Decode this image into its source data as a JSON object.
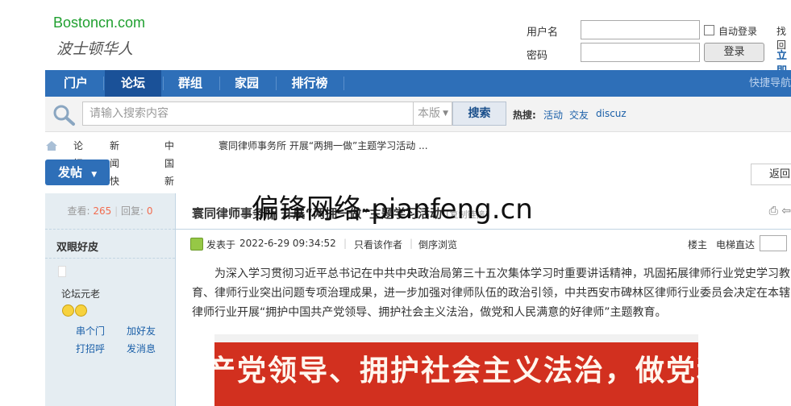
{
  "header": {
    "logo_en": "Bostoncn.com",
    "logo_cn": "波士顿华人",
    "username_label": "用户名",
    "password_label": "密码",
    "auto_login_label": "自动登录",
    "login_button": "登录",
    "retrieve_password": "找回",
    "register": "立即"
  },
  "nav": {
    "items": [
      "门户",
      "论坛",
      "群组",
      "家园",
      "排行榜"
    ],
    "active": "论坛",
    "quick_nav": "快捷导航"
  },
  "search": {
    "placeholder": "请输入搜索内容",
    "scope": "本版",
    "button": "搜索",
    "hot_label": "热搜:",
    "hot_links": [
      "活动",
      "交友",
      "discuz"
    ]
  },
  "breadcrumb": [
    "论坛",
    "新闻快递",
    "中国新闻",
    "寰同律师事务所 开展“两拥一做”主题学习活动 ..."
  ],
  "actions": {
    "post_button": "发帖",
    "back_button": "返回"
  },
  "sidebar": {
    "views_label": "查看:",
    "views_value": "265",
    "replies_label": "回复:",
    "replies_value": "0",
    "username": "双眼好皮",
    "user_level": "论坛元老",
    "links": [
      "串个门",
      "加好友",
      "打招呼",
      "发消息"
    ]
  },
  "post": {
    "title": "寰同律师事务所 开展“两拥一做”主题学习活动",
    "title_tag": "[复制链接]",
    "watermark": "偏锋网络-pianfeng.cn",
    "posted_prefix": "发表于",
    "posted_time": "2022-6-29 09:34:52",
    "author_only": "只看该作者",
    "reverse_view": "倒序浏览",
    "floor_label": "楼主",
    "elevator_label": "电梯直达",
    "body_lines": [
      "为深入学习贯彻习近平总书记在中共中央政治局第三十五次集体学习时重要讲话精神，巩固拓展律师行业党史学习教",
      "育、律师行业突出问题专项治理成果，进一步加强对律师队伍的政治引领，中共西安市碑林区律师行业委员会决定在本辖",
      "律师行业开展“拥护中国共产党领导、拥护社会主义法治，做党和人民满意的好律师”主题教育。"
    ],
    "banner_text": "产党领导、拥护社会主义法治，做党和人民满意的好律师"
  }
}
